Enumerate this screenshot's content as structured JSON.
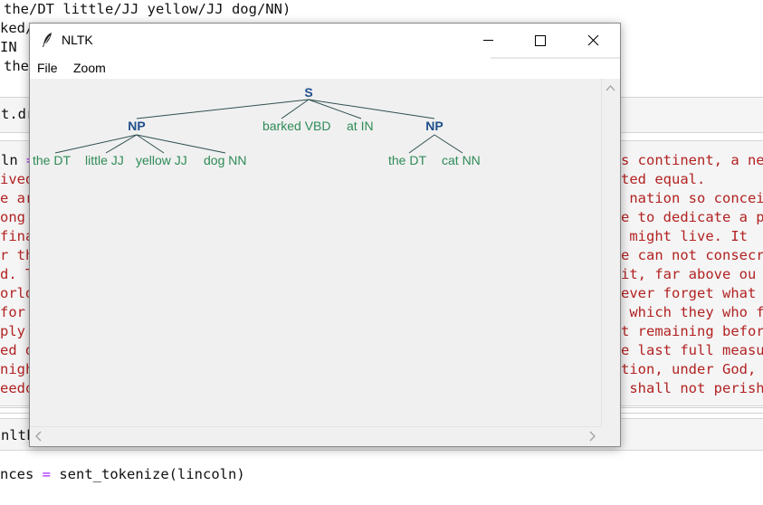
{
  "background": {
    "top_lines": [
      "the/DT little/JJ yellow/JJ dog/NN)",
      "ked/VBD",
      "IN",
      "the"
    ],
    "cell_code": "t.dr",
    "left_fragments": [
      "ln ",
      "ived",
      "e ar",
      "ong ",
      "fina",
      "r th",
      "d. T",
      "orld",
      "for",
      "ply ",
      "ed d",
      "nigh",
      "eedo"
    ],
    "assign_op": "=",
    "right_fragments": [
      "s continent, a new",
      "ted equal.",
      " nation so concei",
      "e to dedicate a p",
      " might live. It",
      "e can not consecr",
      "it, far above ou",
      "ever forget what",
      " which they who f",
      "t remaining befor",
      "e last full measu",
      "tion, under God,",
      " shall not perish"
    ],
    "bottom_line1": "nltk",
    "bottom_line2_pre": "nces ",
    "bottom_line2_eq": "=",
    "bottom_line2_post": " sent_tokenize(lincoln)"
  },
  "window": {
    "title": "NLTK",
    "menu": [
      "File",
      "Zoom"
    ],
    "buttons": [
      "minimize",
      "maximize",
      "close"
    ]
  },
  "tree": {
    "root": "S",
    "np1": "NP",
    "np2": "NP",
    "leaves_np1": [
      "the DT",
      "little JJ",
      "yellow JJ",
      "dog NN"
    ],
    "leaves_s": [
      "barked VBD",
      "at IN"
    ],
    "leaves_np2": [
      "the DT",
      "cat NN"
    ]
  },
  "colors": {
    "nonterminal": "#1f4e8c",
    "leaf": "#2e8b57",
    "code_string": "#b22222",
    "window_bg": "#f0f0f0"
  },
  "icons": [
    "feather-icon",
    "minimize-icon",
    "maximize-icon",
    "close-icon",
    "scroll-up-icon",
    "scroll-left-icon",
    "scroll-right-icon"
  ]
}
